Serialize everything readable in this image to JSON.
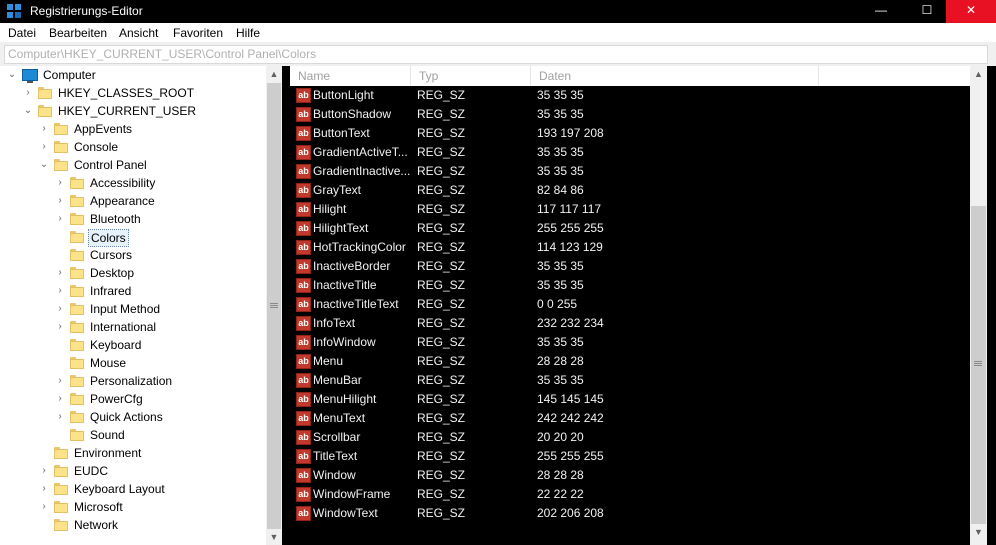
{
  "window": {
    "title": "Registrierungs-Editor",
    "minimize_glyph": "—",
    "maximize_glyph": "☐",
    "close_glyph": "✕"
  },
  "menu": [
    "Datei",
    "Bearbeiten",
    "Ansicht",
    "Favoriten",
    "Hilfe"
  ],
  "address": {
    "value": "Computer\\HKEY_CURRENT_USER\\Control Panel\\Colors"
  },
  "tree": {
    "root": "Computer",
    "items": [
      {
        "label": "HKEY_CLASSES_ROOT",
        "expander": "›"
      },
      {
        "label": "HKEY_CURRENT_USER",
        "expander": "⌄"
      },
      {
        "label": "AppEvents",
        "expander": "›"
      },
      {
        "label": "Console",
        "expander": "›"
      },
      {
        "label": "Control Panel",
        "expander": "⌄"
      },
      {
        "label": "Accessibility",
        "expander": "›"
      },
      {
        "label": "Appearance",
        "expander": "›"
      },
      {
        "label": "Bluetooth",
        "expander": "›"
      },
      {
        "label": "Colors",
        "expander": ""
      },
      {
        "label": "Cursors",
        "expander": ""
      },
      {
        "label": "Desktop",
        "expander": "›"
      },
      {
        "label": "Infrared",
        "expander": "›"
      },
      {
        "label": "Input Method",
        "expander": "›"
      },
      {
        "label": "International",
        "expander": "›"
      },
      {
        "label": "Keyboard",
        "expander": ""
      },
      {
        "label": "Mouse",
        "expander": ""
      },
      {
        "label": "Personalization",
        "expander": "›"
      },
      {
        "label": "PowerCfg",
        "expander": "›"
      },
      {
        "label": "Quick Actions",
        "expander": "›"
      },
      {
        "label": "Sound",
        "expander": ""
      },
      {
        "label": "Environment",
        "expander": ""
      },
      {
        "label": "EUDC",
        "expander": "›"
      },
      {
        "label": "Keyboard Layout",
        "expander": "›"
      },
      {
        "label": "Microsoft",
        "expander": "›"
      },
      {
        "label": "Network",
        "expander": ""
      }
    ]
  },
  "list": {
    "columns": [
      "Name",
      "Typ",
      "Daten"
    ],
    "rows": [
      {
        "name": "ButtonLight",
        "type": "REG_SZ",
        "data": "35 35 35"
      },
      {
        "name": "ButtonShadow",
        "type": "REG_SZ",
        "data": "35 35 35"
      },
      {
        "name": "ButtonText",
        "type": "REG_SZ",
        "data": "193 197 208"
      },
      {
        "name": "GradientActiveT...",
        "type": "REG_SZ",
        "data": "35 35 35"
      },
      {
        "name": "GradientInactive...",
        "type": "REG_SZ",
        "data": "35 35 35"
      },
      {
        "name": "GrayText",
        "type": "REG_SZ",
        "data": "82 84 86"
      },
      {
        "name": "Hilight",
        "type": "REG_SZ",
        "data": "117 117 117"
      },
      {
        "name": "HilightText",
        "type": "REG_SZ",
        "data": "255 255 255"
      },
      {
        "name": "HotTrackingColor",
        "type": "REG_SZ",
        "data": "114 123 129"
      },
      {
        "name": "InactiveBorder",
        "type": "REG_SZ",
        "data": "35 35 35"
      },
      {
        "name": "InactiveTitle",
        "type": "REG_SZ",
        "data": "35 35 35"
      },
      {
        "name": "InactiveTitleText",
        "type": "REG_SZ",
        "data": "0 0 255"
      },
      {
        "name": "InfoText",
        "type": "REG_SZ",
        "data": "232 232 234"
      },
      {
        "name": "InfoWindow",
        "type": "REG_SZ",
        "data": "35 35 35"
      },
      {
        "name": "Menu",
        "type": "REG_SZ",
        "data": "28 28 28"
      },
      {
        "name": "MenuBar",
        "type": "REG_SZ",
        "data": "35 35 35"
      },
      {
        "name": "MenuHilight",
        "type": "REG_SZ",
        "data": "145 145 145"
      },
      {
        "name": "MenuText",
        "type": "REG_SZ",
        "data": "242 242 242"
      },
      {
        "name": "Scrollbar",
        "type": "REG_SZ",
        "data": "20 20 20"
      },
      {
        "name": "TitleText",
        "type": "REG_SZ",
        "data": "255 255 255"
      },
      {
        "name": "Window",
        "type": "REG_SZ",
        "data": "28 28 28"
      },
      {
        "name": "WindowFrame",
        "type": "REG_SZ",
        "data": "22 22 22"
      },
      {
        "name": "WindowText",
        "type": "REG_SZ",
        "data": "202 206 208"
      }
    ],
    "value_icon_text": "ab"
  },
  "colors": {
    "close_button": "#e81123",
    "list_background": "#000000",
    "list_text": "#f2f2f2",
    "folder": "#fce28a",
    "selection_border": "#6f8aa8"
  },
  "icons": {
    "app": "registry-editor-icon",
    "computer": "computer-icon",
    "folder": "folder-icon",
    "string_value": "string-value-icon"
  }
}
